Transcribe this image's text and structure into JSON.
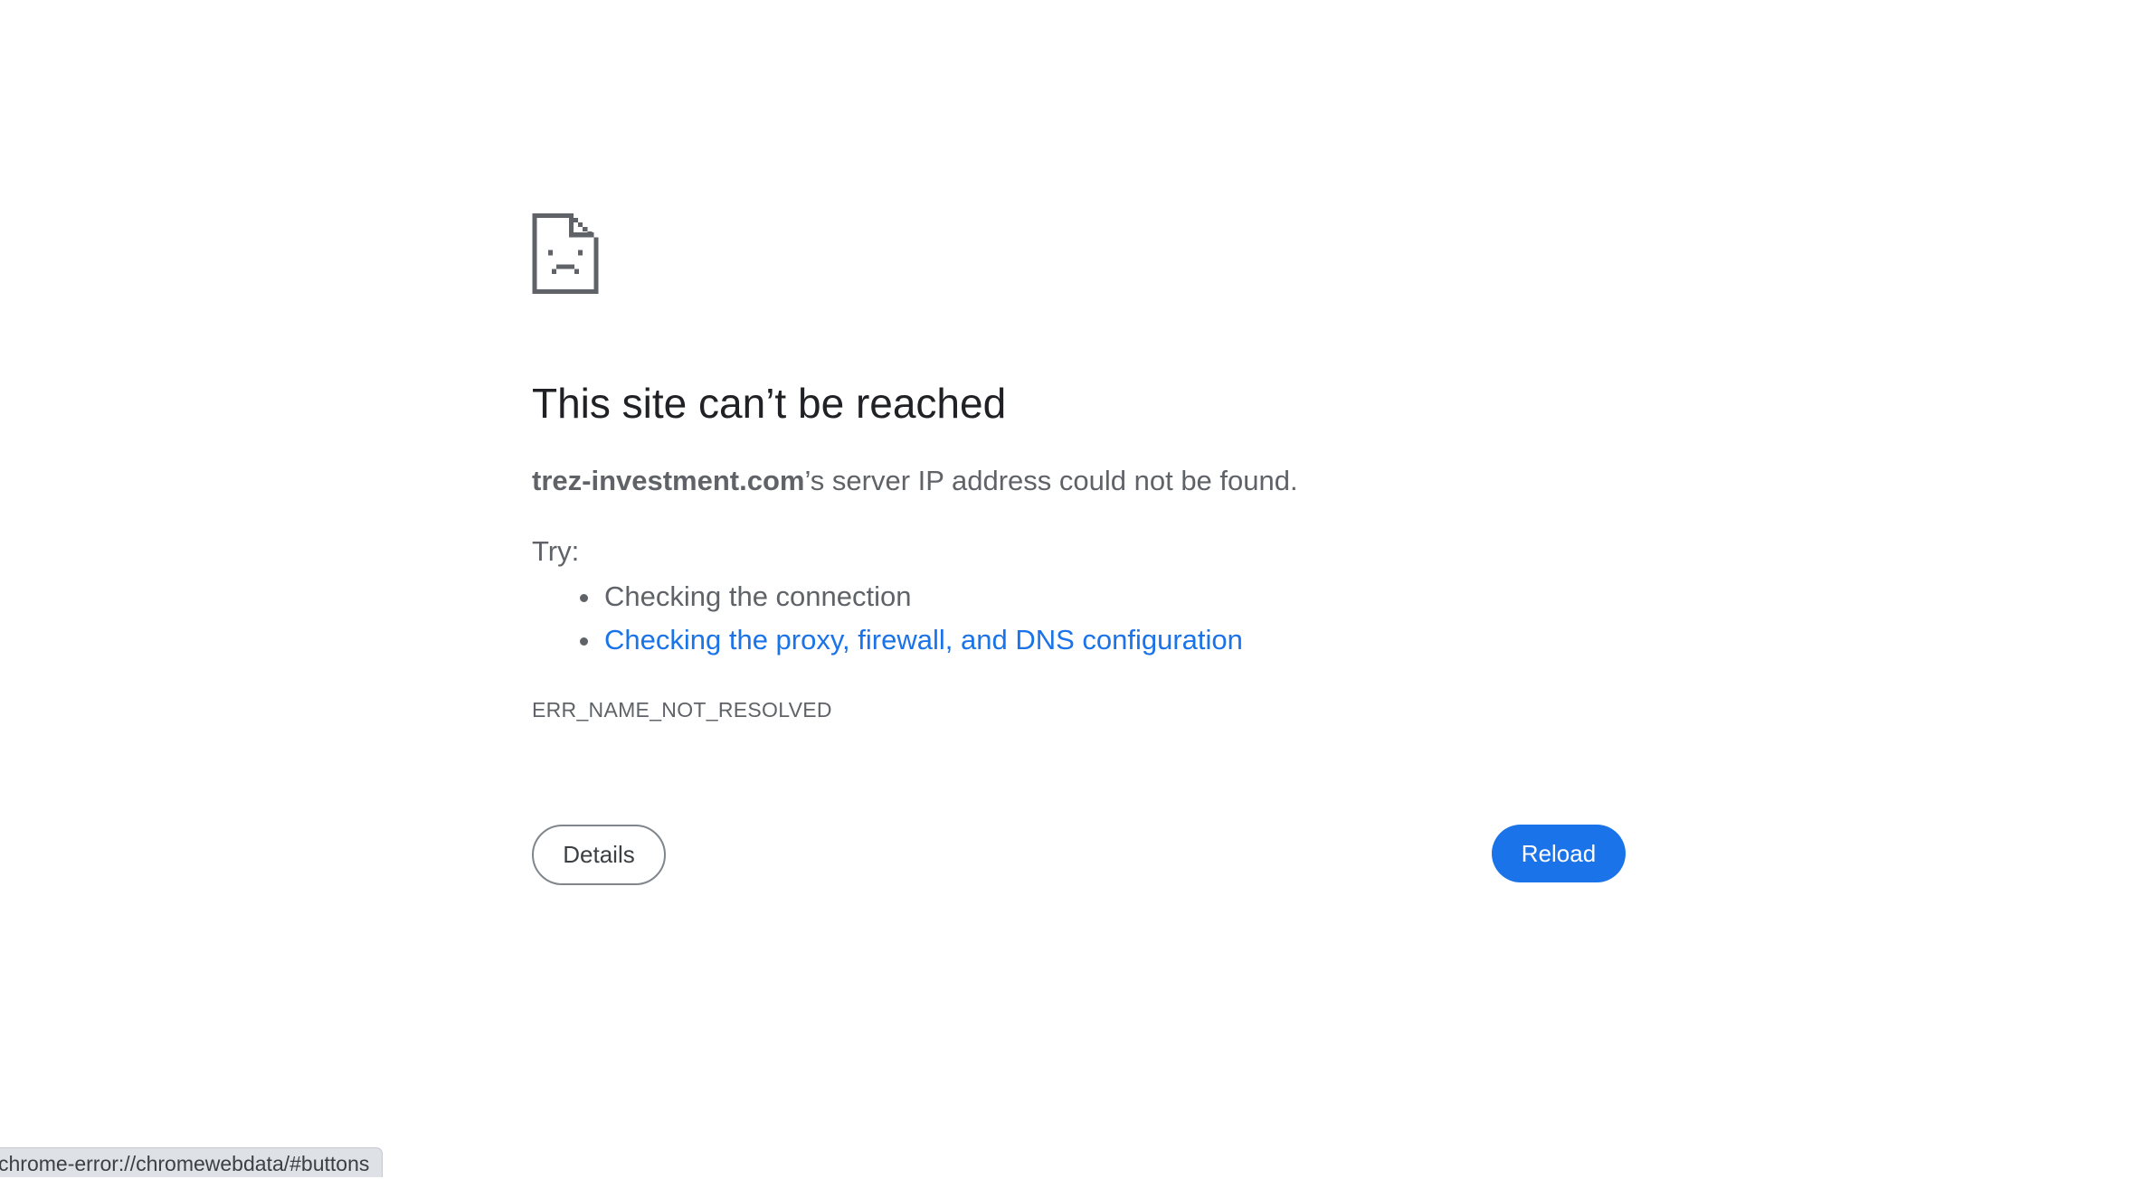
{
  "error": {
    "icon": "sad-page-icon",
    "title": "This site can’t be reached",
    "host": "trez-investment.com",
    "summary_rest": "’s server IP address could not be found.",
    "try_label": "Try:",
    "suggestions": [
      {
        "text": "Checking the connection",
        "is_link": false
      },
      {
        "text": "Checking the proxy, firewall, and DNS configuration",
        "is_link": true
      }
    ],
    "code": "ERR_NAME_NOT_RESOLVED"
  },
  "buttons": {
    "details_label": "Details",
    "reload_label": "Reload"
  },
  "status_bar": {
    "url": "chrome-error://chromewebdata/#buttons"
  },
  "colors": {
    "title": "#202124",
    "body_text": "#5f6368",
    "link": "#1a73e8",
    "primary_button": "#1a73e8",
    "status_bubble_bg": "#dee1e6"
  }
}
